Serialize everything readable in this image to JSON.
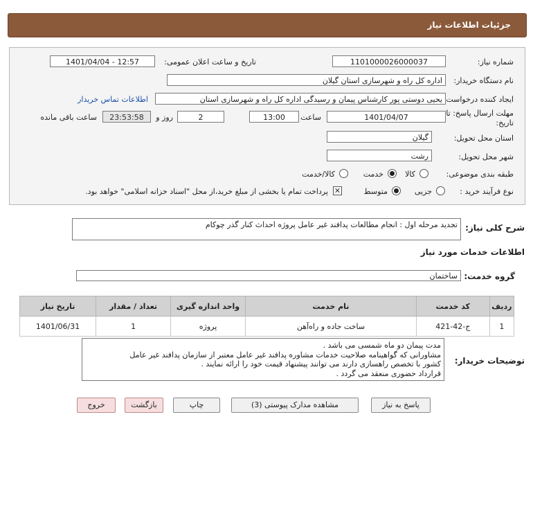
{
  "header": {
    "title": "جزئیات اطلاعات نیاز"
  },
  "fields": {
    "need_number_label": "شماره نیاز:",
    "need_number": "1101000026000037",
    "announce_label": "تاریخ و ساعت اعلان عمومی:",
    "announce_value": "1401/04/04 - 12:57",
    "buyer_org_label": "نام دستگاه خریدار:",
    "buyer_org": "اداره کل راه و شهرسازی استان گیلان",
    "creator_label": "ایجاد کننده درخواست:",
    "creator": "یحیی دوستی پور کارشناس پیمان و رسیدگی اداره کل راه و شهرسازی استان",
    "contact_link": "اطلاعات تماس خریدار",
    "deadline_label": "مهلت ارسال پاسخ: تا تاریخ:",
    "deadline_date": "1401/04/07",
    "time_label": "ساعت",
    "deadline_time": "13:00",
    "days_value": "2",
    "days_label": "روز و",
    "remaining_time": "23:53:58",
    "remaining_label": "ساعت باقی مانده",
    "province_label": "استان محل تحویل:",
    "province": "گیلان",
    "city_label": "شهر محل تحویل:",
    "city": "رشت",
    "category_label": "طبقه بندی موضوعی:",
    "category_options": [
      "کالا",
      "خدمت",
      "کالا/خدمت"
    ],
    "category_selected": "خدمت",
    "process_label": "نوع فرآیند خرید :",
    "process_options": [
      "جزیی",
      "متوسط"
    ],
    "process_selected": "متوسط",
    "payment_note": "پرداخت تمام یا بخشی از مبلغ خرید،از محل \"اسناد خزانه اسلامی\" خواهد بود."
  },
  "summary": {
    "label": "شرح کلی نیاز:",
    "value": "تجدید مرحله اول : انجام مطالعات پدافند غیر عامل پروژه احداث کنار گذر چوکام"
  },
  "services": {
    "section_title": "اطلاعات خدمات مورد نیاز",
    "group_label": "گروه خدمت:",
    "group_value": "ساختمان",
    "columns": [
      "ردیف",
      "کد خدمت",
      "نام خدمت",
      "واحد اندازه گیری",
      "تعداد / مقدار",
      "تاریخ نیاز"
    ],
    "rows": [
      [
        "1",
        "ج-42-421",
        "ساخت جاده و راه‌آهن",
        "پروژه",
        "1",
        "1401/06/31"
      ]
    ]
  },
  "buyer_notes": {
    "label": "توضیحات خریدار:",
    "lines": [
      "مدت پیمان دو ماه شمسی می باشد .",
      "مشاورانی که گواهینامه صلاحیت خدمات مشاوره پدافند غیر عامل معتبر از سازمان پدافند غیر عامل",
      "کشور با تخصص راهسازی دارند می توانند پیشنهاد قیمت خود را ارائه نمایند .",
      "قرارداد حضوری منعقد می گردد ."
    ]
  },
  "buttons": {
    "reply": "پاسخ به نیاز",
    "attachments": "مشاهده مدارک پیوستی (3)",
    "print": "چاپ",
    "back": "بازگشت",
    "exit": "خروج"
  }
}
